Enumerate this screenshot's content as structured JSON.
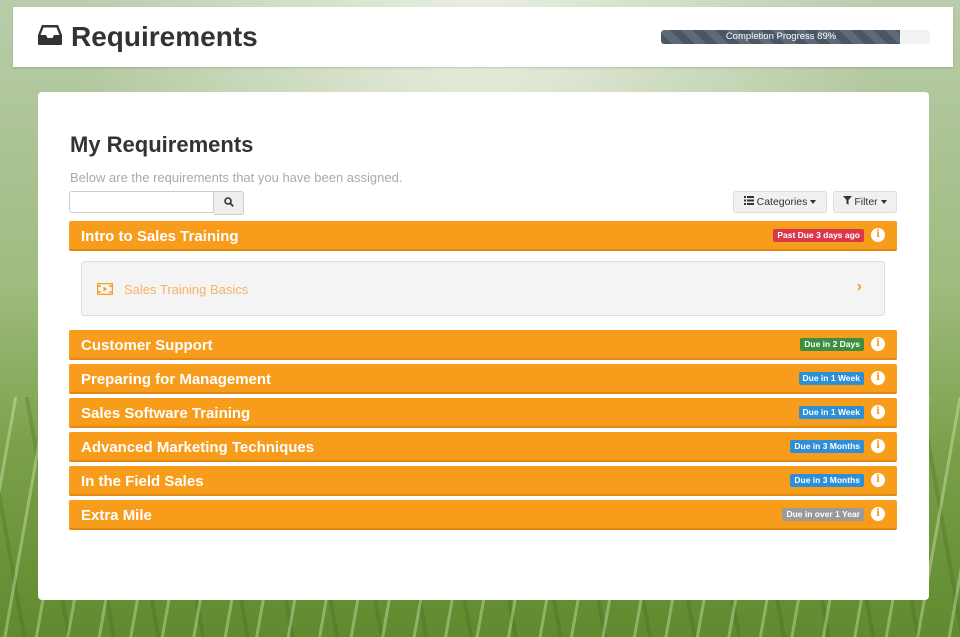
{
  "header": {
    "title": "Requirements",
    "progress_label": "Completion Progress 89%",
    "progress_value": 0.89
  },
  "main": {
    "heading": "My Requirements",
    "subtitle": "Below are the requirements that you have been assigned.",
    "search_placeholder": "",
    "categories_label": "Categories",
    "filter_label": "Filter"
  },
  "requirements": [
    {
      "name": "Intro to Sales Training",
      "badge": "Past Due 3 days ago",
      "badge_color": "#d9384a",
      "expanded": true,
      "items": [
        {
          "name": "Sales Training Basics"
        }
      ]
    },
    {
      "name": "Customer Support",
      "badge": "Due in 2 Days",
      "badge_color": "#3e8e41"
    },
    {
      "name": "Preparing for Management",
      "badge": "Due in 1 Week",
      "badge_color": "#2d8fd5"
    },
    {
      "name": "Sales Software Training",
      "badge": "Due in 1 Week",
      "badge_color": "#2d8fd5"
    },
    {
      "name": "Advanced Marketing Techniques",
      "badge": "Due in 3 Months",
      "badge_color": "#2d8fd5"
    },
    {
      "name": "In the Field Sales",
      "badge": "Due in 3 Months",
      "badge_color": "#2d8fd5"
    },
    {
      "name": "Extra Mile",
      "badge": "Due in over 1 Year",
      "badge_color": "#9a9a9a"
    }
  ],
  "icons": {
    "title": "inbox-icon",
    "search": "search-icon",
    "categories": "list-icon",
    "filter": "funnel-icon",
    "info": "info-icon",
    "item": "video-icon",
    "expand": "chevron-right-icon"
  }
}
